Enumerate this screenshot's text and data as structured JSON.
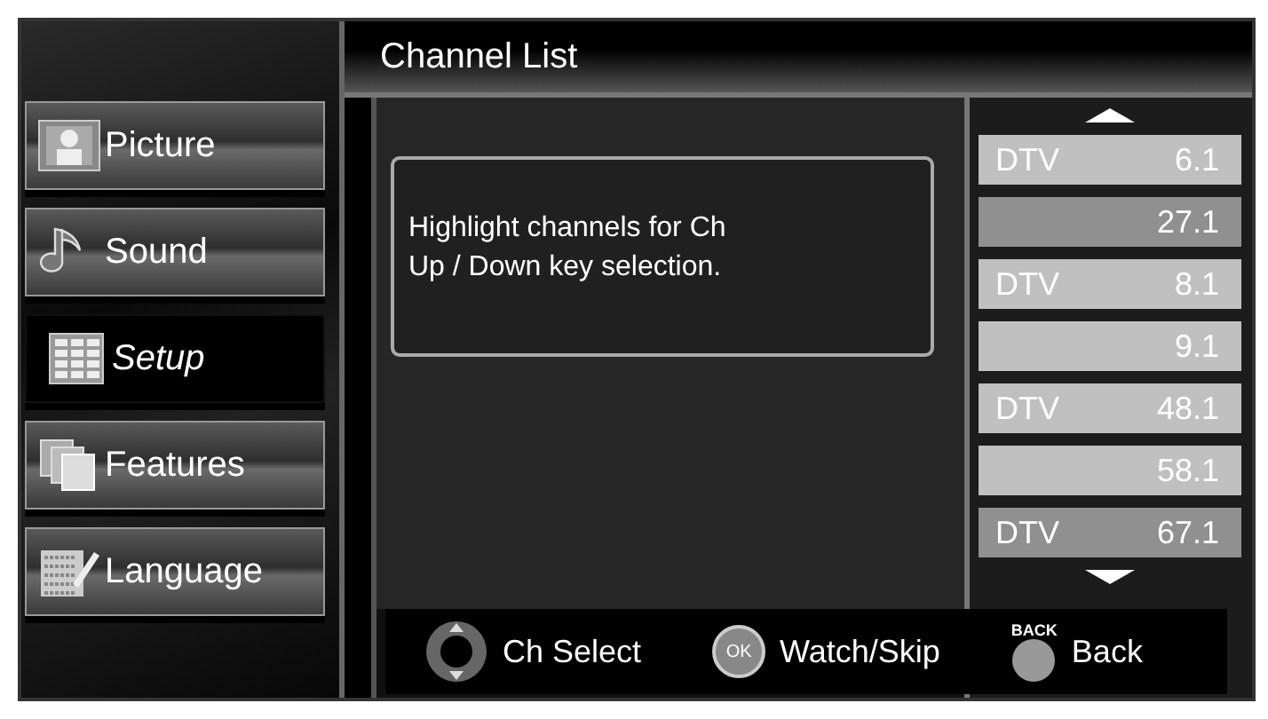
{
  "header": {
    "title": "Channel List"
  },
  "menu": [
    {
      "label": "Picture",
      "kind": "picture",
      "selected": false
    },
    {
      "label": "Sound",
      "kind": "sound",
      "selected": false
    },
    {
      "label": "Setup",
      "kind": "setup",
      "selected": true
    },
    {
      "label": "Features",
      "kind": "features",
      "selected": false
    },
    {
      "label": "Language",
      "kind": "language",
      "selected": false
    }
  ],
  "info": "Highlight channels for Ch\nUp / Down key selection.",
  "channels": [
    {
      "type": "DTV",
      "number": "6.1",
      "highlighted": true
    },
    {
      "number": "27.1",
      "highlighted": false
    },
    {
      "type": "DTV",
      "number": "8.1",
      "highlighted": true
    },
    {
      "number": "9.1",
      "highlighted": true
    },
    {
      "type": "DTV",
      "number": "48.1",
      "highlighted": true
    },
    {
      "number": "58.1",
      "highlighted": true
    },
    {
      "type": "DTV",
      "number": "67.1",
      "highlighted": false
    }
  ],
  "footer": [
    {
      "kind": "dpad",
      "label": "Ch Select"
    },
    {
      "kind": "ok",
      "key": "OK",
      "label": "Watch/Skip"
    },
    {
      "kind": "back",
      "key": "BACK",
      "label": "Back"
    }
  ]
}
